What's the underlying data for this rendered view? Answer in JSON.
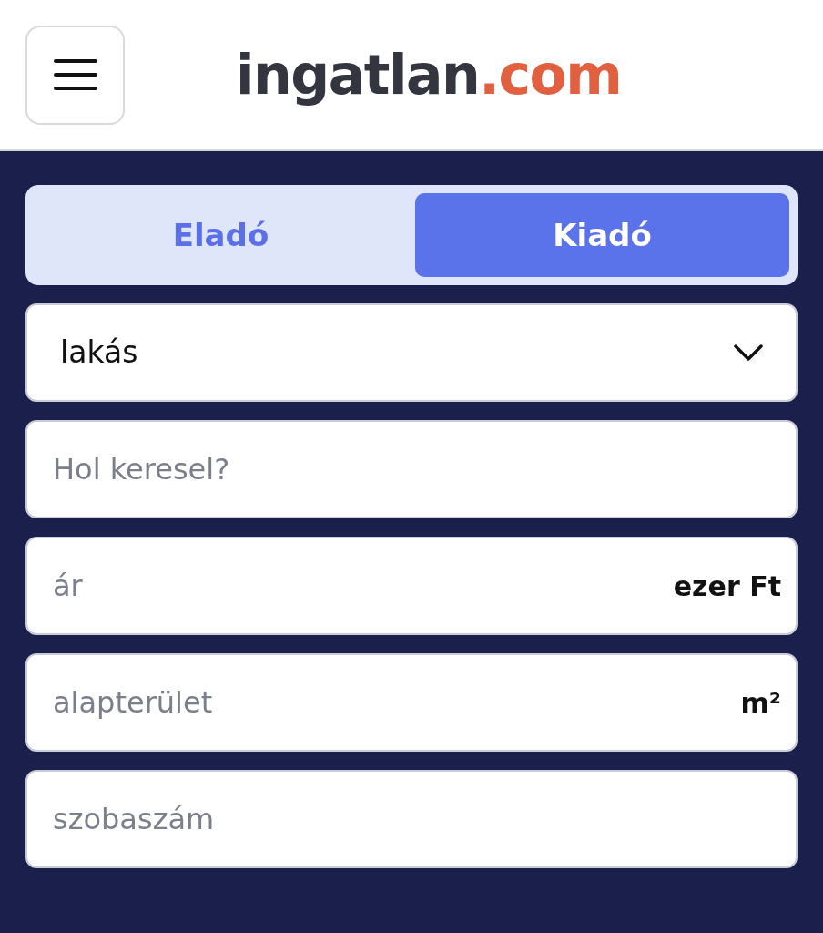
{
  "header": {
    "logo": {
      "name": "ingatlan",
      "tld": ".com"
    }
  },
  "tabs": [
    {
      "label": "Eladó",
      "selected": false
    },
    {
      "label": "Kiadó",
      "selected": true
    }
  ],
  "fields": [
    {
      "kind": "select",
      "value": "lakás"
    },
    {
      "kind": "text",
      "placeholder": "Hol keresel?"
    },
    {
      "kind": "text",
      "placeholder": "ár",
      "suffix": "ezer Ft"
    },
    {
      "kind": "text",
      "placeholder": "alapterület",
      "suffix": "m²"
    },
    {
      "kind": "text",
      "placeholder": "szobaszám"
    }
  ]
}
